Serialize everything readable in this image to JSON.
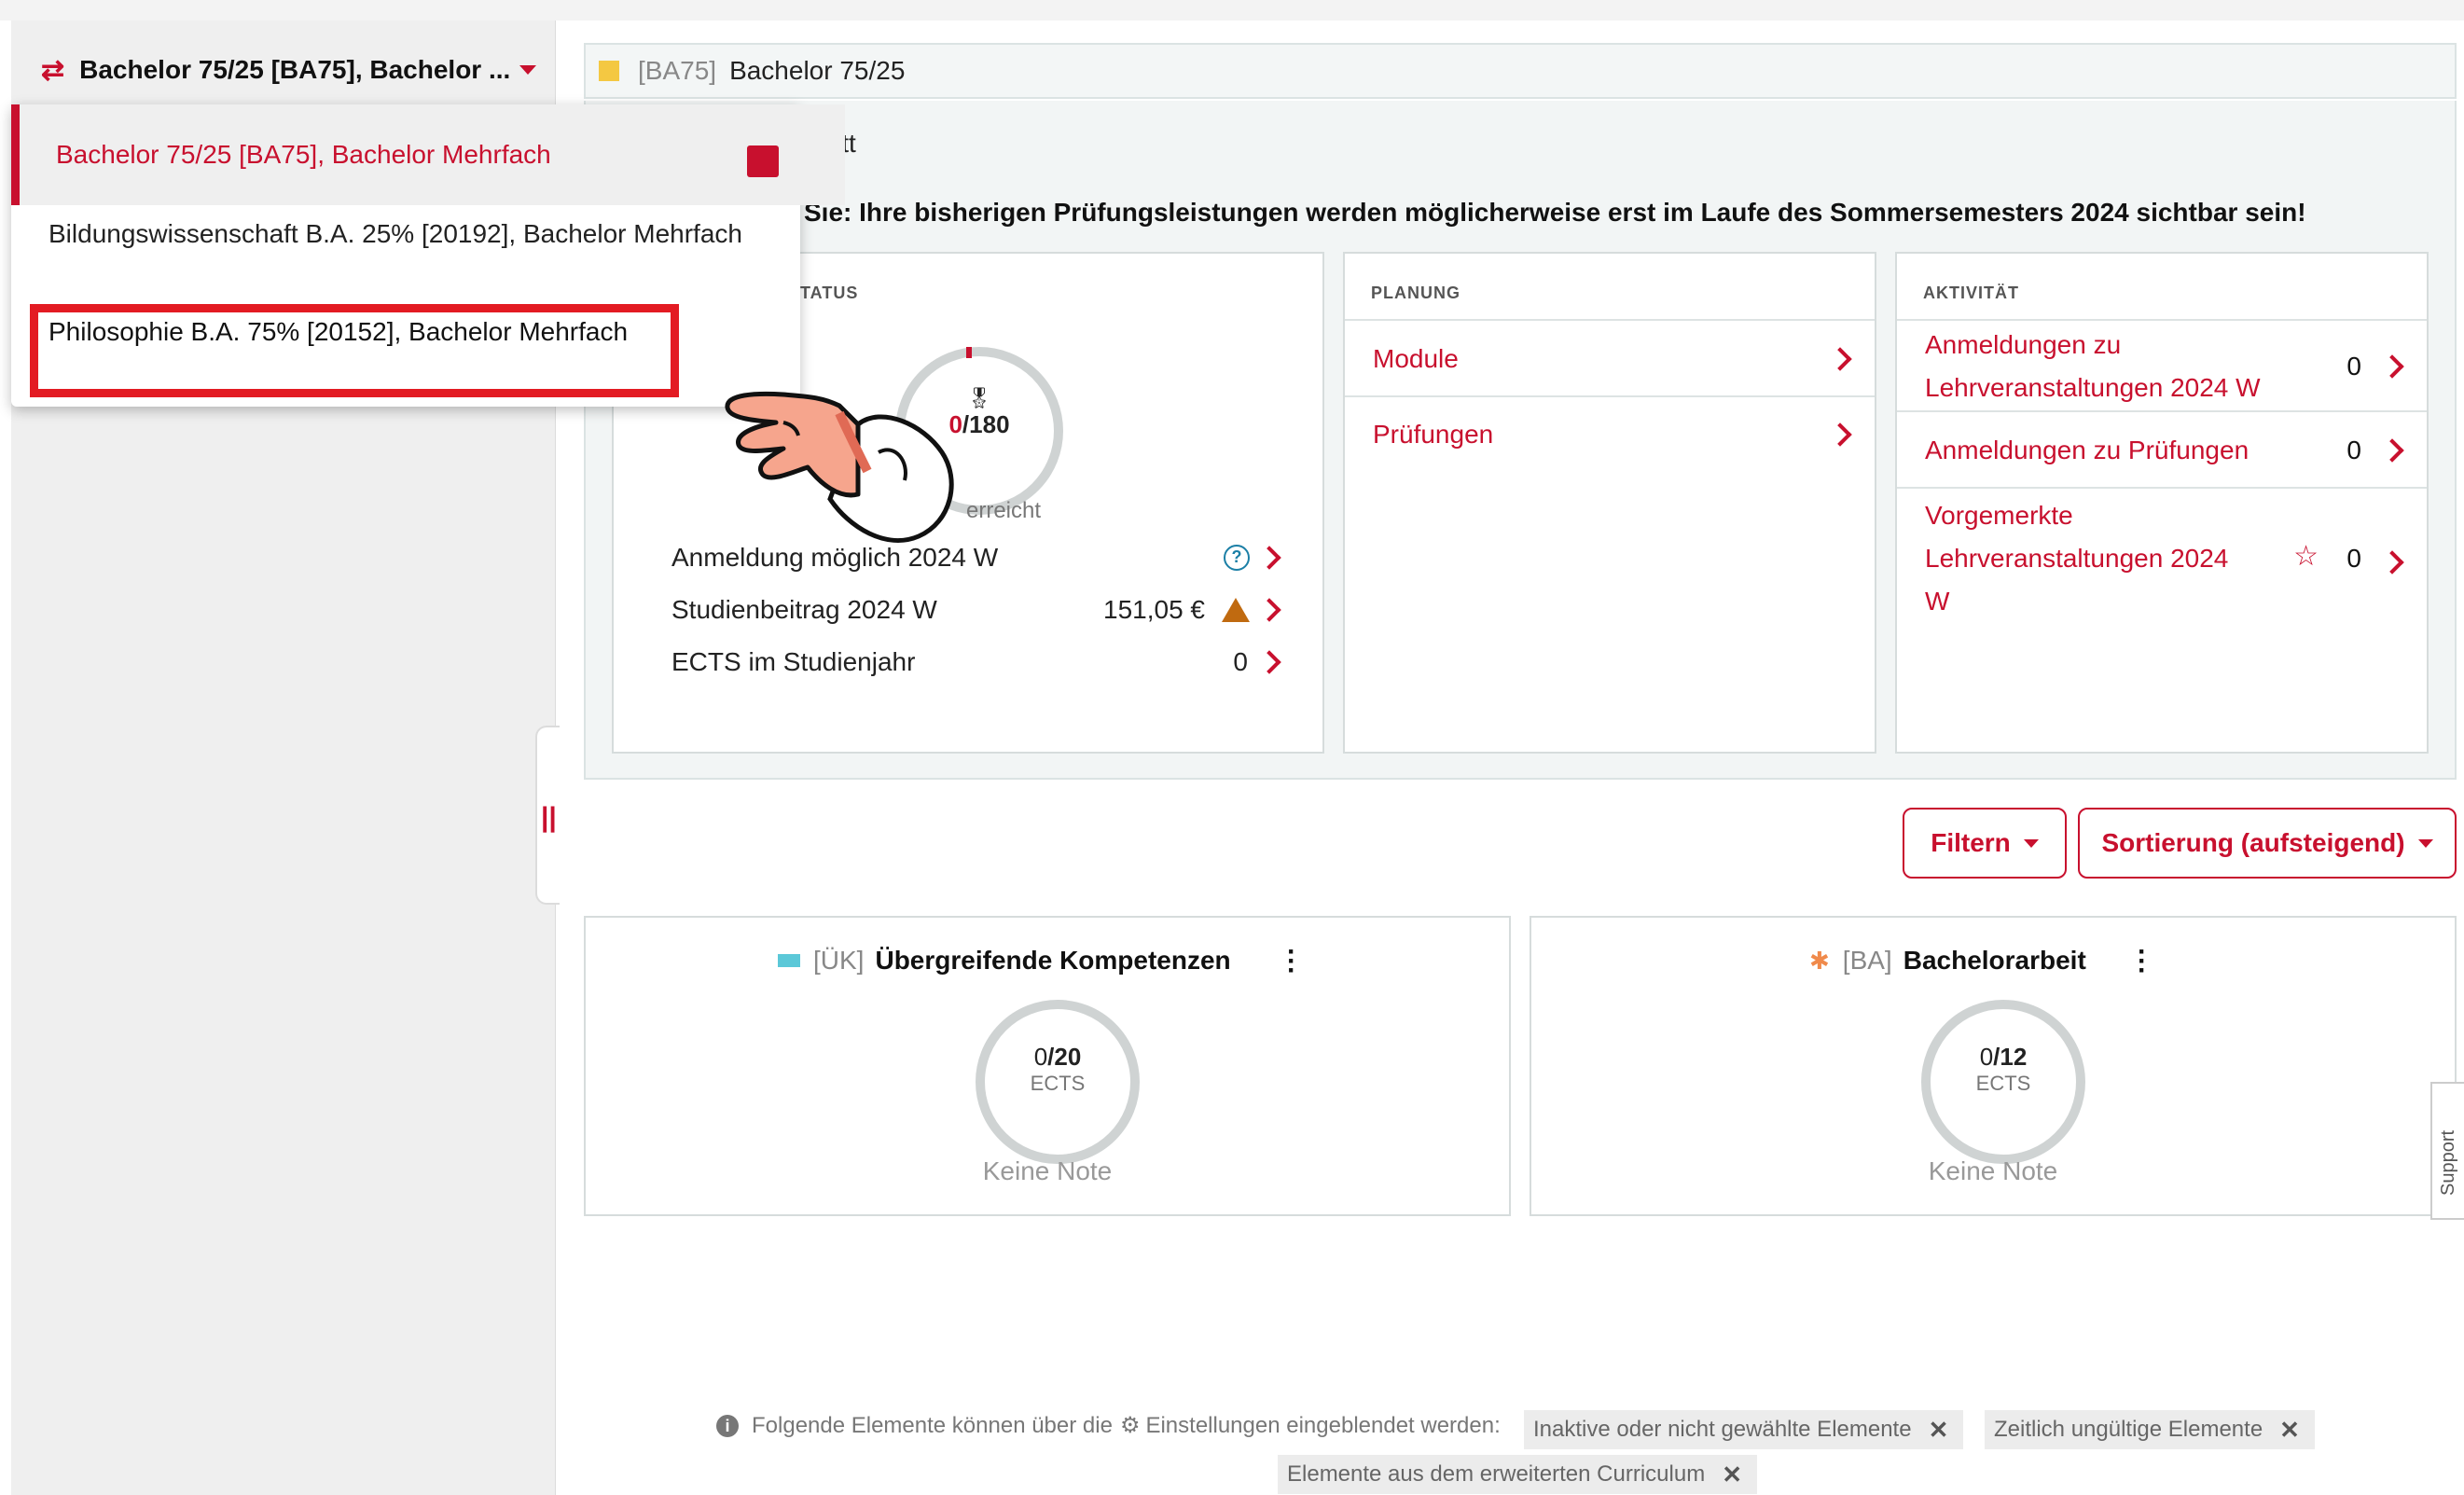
{
  "selector": {
    "label": "Bachelor 75/25 [BA75], Bachelor ...",
    "icon": "switch-arrows-icon"
  },
  "dropdown": {
    "items": [
      {
        "label": "Bachelor 75/25 [BA75], Bachelor Mehrfach",
        "active": true
      },
      {
        "label": "Bildungswissenschaft B.A. 25% [20192], Bachelor Mehrfach"
      },
      {
        "label": "Philosophie B.A. 75% [20152], Bachelor Mehrfach"
      }
    ]
  },
  "program_bar": {
    "code": "[BA75]",
    "title": "Bachelor 75/25"
  },
  "progress": {
    "title_partial": "rtschritt",
    "notice_partial": "Sie: Ihre bisherigen Prüfungsleistungen werden möglicherweise erst im Laufe des Sommersemesters 2024 sichtbar sein!"
  },
  "status_card": {
    "head_partial": "TATUS",
    "gauge_value": "0",
    "gauge_total": "/180",
    "gauge_caption_partial": "erreicht",
    "rows": [
      {
        "label": "Anmeldung möglich 2024 W",
        "value": ""
      },
      {
        "label": "Studienbeitrag 2024 W",
        "value": "151,05 €"
      },
      {
        "label": "ECTS im Studienjahr",
        "value": "0"
      }
    ]
  },
  "planung_card": {
    "head": "PLANUNG",
    "rows": [
      {
        "label": "Module"
      },
      {
        "label": "Prüfungen"
      }
    ]
  },
  "aktivitaet_card": {
    "head": "AKTIVITÄT",
    "rows": [
      {
        "line1": "Anmeldungen zu",
        "line2": "Lehrveranstaltungen 2024 W",
        "count": "0"
      },
      {
        "line1": "Anmeldungen zu Prüfungen",
        "count": "0"
      },
      {
        "line1": "Vorgemerkte",
        "line2": "Lehrveranstaltungen 2024",
        "line3": "W",
        "count": "0"
      }
    ]
  },
  "buttons": {
    "filter": "Filtern",
    "sort": "Sortierung (aufsteigend)"
  },
  "modules": [
    {
      "code": "[ÜK]",
      "title": "Übergreifende Kompetenzen",
      "value": "0",
      "total": "/20",
      "unit": "ECTS",
      "grade": "Keine Note",
      "color": "#5bc8d8"
    },
    {
      "code": "[BA]",
      "title": "Bachelorarbeit",
      "value": "0",
      "total": "/12",
      "unit": "ECTS",
      "grade": "Keine Note",
      "color": "#f08a4b"
    }
  ],
  "support": "Support",
  "hint": {
    "text_before": "Folgende Elemente können über die",
    "text_after": "Einstellungen eingeblendet werden:",
    "tags": [
      "Inaktive oder nicht gewählte Elemente",
      "Zeitlich ungültige Elemente",
      "Elemente aus dem erweiterten Curriculum"
    ]
  },
  "colors": {
    "accent": "#c8102e",
    "highlight": "#e31b23",
    "program_square": "#f4c842"
  }
}
